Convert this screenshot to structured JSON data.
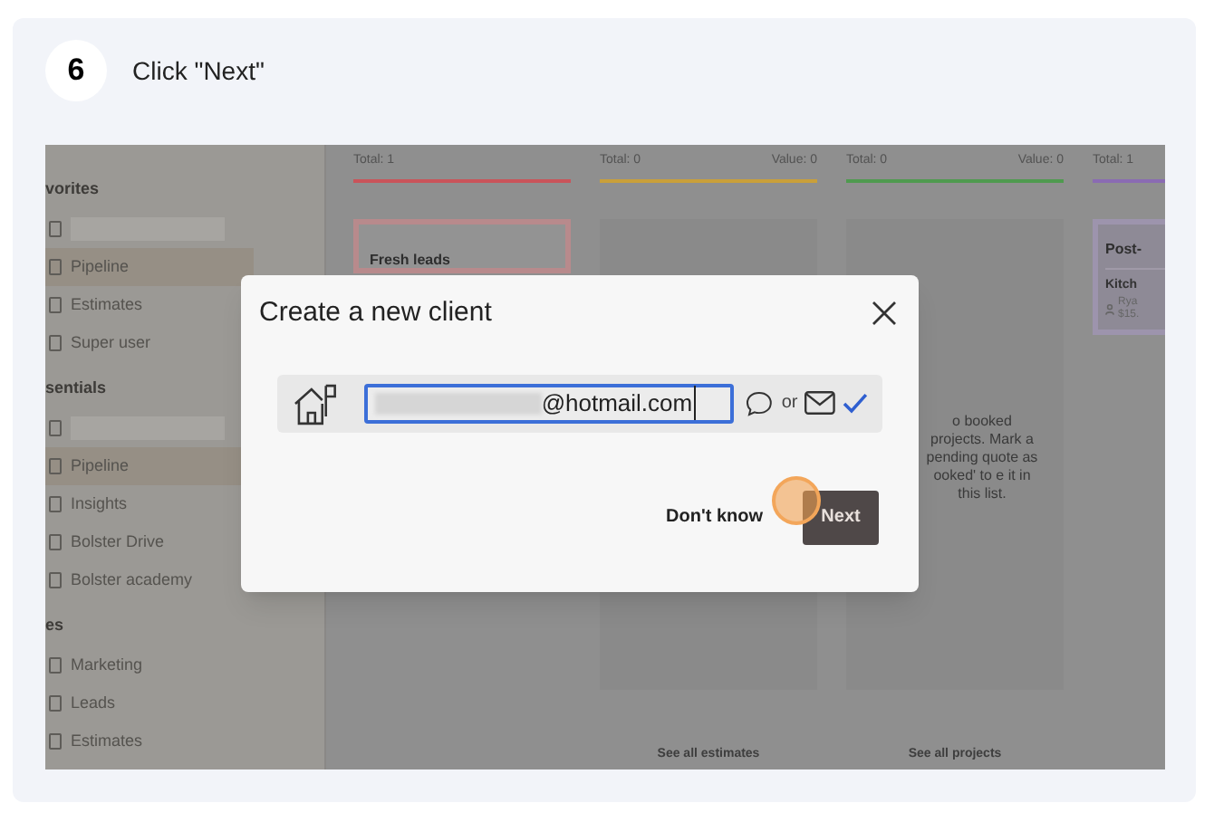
{
  "step": {
    "number": "6",
    "instruction": "Click \"Next\""
  },
  "sidebar": {
    "sections": [
      {
        "heading": "vorites",
        "items": [
          {
            "kind": "redacted"
          },
          {
            "kind": "link",
            "label": "Pipeline",
            "selected": true
          },
          {
            "kind": "link",
            "label": "Estimates",
            "selected": false
          },
          {
            "kind": "link",
            "label": "Super user",
            "selected": false
          }
        ]
      },
      {
        "heading": "sentials",
        "items": [
          {
            "kind": "redacted"
          },
          {
            "kind": "link",
            "label": "Pipeline",
            "selected": true
          },
          {
            "kind": "link",
            "label": "Insights",
            "selected": false
          },
          {
            "kind": "link",
            "label": "Bolster Drive",
            "selected": false
          },
          {
            "kind": "link",
            "label": "Bolster academy",
            "selected": false
          }
        ]
      },
      {
        "heading": "es",
        "items": [
          {
            "kind": "link",
            "label": "Marketing",
            "selected": false
          },
          {
            "kind": "link",
            "label": "Leads",
            "selected": false
          },
          {
            "kind": "link",
            "label": "Estimates",
            "selected": false
          }
        ]
      }
    ]
  },
  "board": {
    "columns": [
      {
        "kind": "card",
        "total": "Total: 1",
        "color": "#c9545a",
        "card_title": "Fresh leads"
      },
      {
        "kind": "empty",
        "total": "Total: 0",
        "value": "Value: 0",
        "color": "#c9a03a",
        "footer_link": "See all estimates"
      },
      {
        "kind": "note",
        "total": "Total: 0",
        "value": "Value: 0",
        "color": "#4f9a4f",
        "note": "o booked projects. Mark a pending quote as ooked' to e it in this list.",
        "footer_link": "See all projects"
      },
      {
        "kind": "cards",
        "total": "Total: 1",
        "color": "#8a6bb3",
        "card_title": "Post-",
        "job_title": "Kitch",
        "job_client": "Rya",
        "job_amount": "$15."
      }
    ]
  },
  "dialog": {
    "title": "Create a new client",
    "email": {
      "value": "@hotmail.com"
    },
    "separator": "or",
    "email_confirmed": true,
    "buttons": [
      {
        "label": "Don't know",
        "kind": "text"
      },
      {
        "label": "Next",
        "kind": "primary"
      }
    ]
  }
}
